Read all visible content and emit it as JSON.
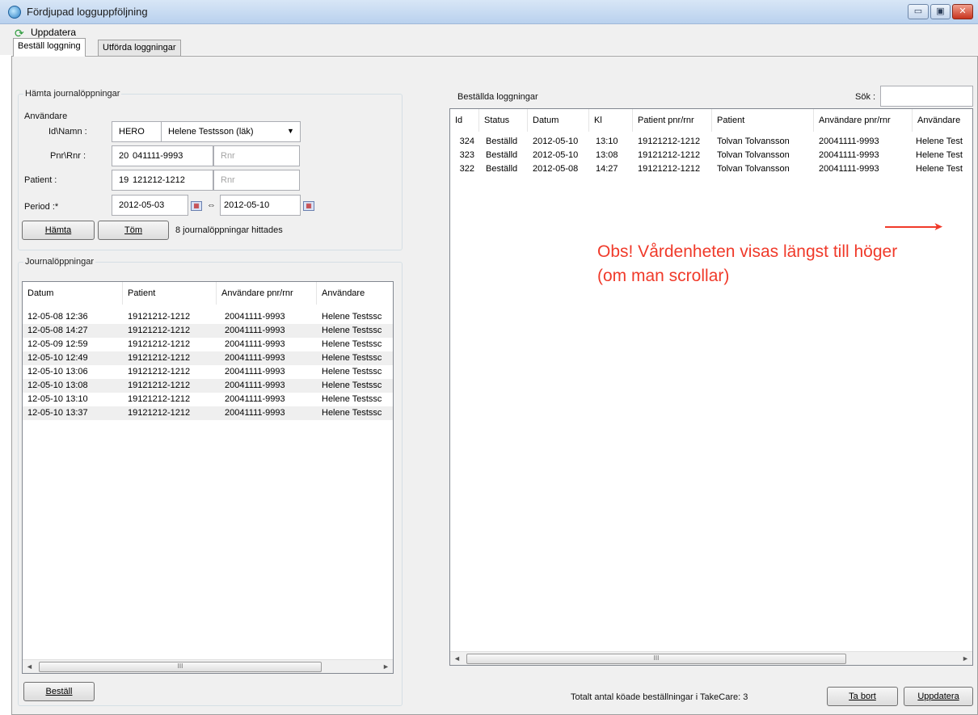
{
  "window": {
    "title": "Fördjupad logguppföljning",
    "minimize": "▭",
    "maximize": "▣",
    "close": "✕"
  },
  "toolbar": {
    "refresh_label": "Uppdatera"
  },
  "tabs": [
    {
      "label": "Beställ loggning",
      "active": true
    },
    {
      "label": "Utförda loggningar",
      "active": false
    }
  ],
  "fetch_group": {
    "legend": "Hämta journalöppningar",
    "user_label": "Användare",
    "idname_label": "Id\\Namn :",
    "user_id": "HERO",
    "user_name": "Helene Testsson (läk)",
    "pnr_label": "Pnr\\Rnr :",
    "user_pnr_century": "20",
    "user_pnr": "041111-9993",
    "rnr_placeholder": "Rnr",
    "patient_label": "Patient :",
    "patient_pnr_century": "19",
    "patient_pnr": "121212-1212",
    "period_label": "Period :*",
    "period_from": "2012-05-03",
    "period_sep": "⇔",
    "period_to": "2012-05-10",
    "fetch_button": "Hämta",
    "clear_button": "Töm",
    "result_text": "8 journalöppningar hittades"
  },
  "openings": {
    "legend": "Journalöppningar",
    "columns": [
      "Datum",
      "Patient",
      "Användare pnr/rnr",
      "Användare"
    ],
    "rows": [
      [
        "12-05-08 12:36",
        "19121212-1212",
        "20041111-9993",
        "Helene Testssc"
      ],
      [
        "12-05-08 14:27",
        "19121212-1212",
        "20041111-9993",
        "Helene Testssc"
      ],
      [
        "12-05-09 12:59",
        "19121212-1212",
        "20041111-9993",
        "Helene Testssc"
      ],
      [
        "12-05-10 12:49",
        "19121212-1212",
        "20041111-9993",
        "Helene Testssc"
      ],
      [
        "12-05-10 13:06",
        "19121212-1212",
        "20041111-9993",
        "Helene Testssc"
      ],
      [
        "12-05-10 13:08",
        "19121212-1212",
        "20041111-9993",
        "Helene Testssc"
      ],
      [
        "12-05-10 13:10",
        "19121212-1212",
        "20041111-9993",
        "Helene Testssc"
      ],
      [
        "12-05-10 13:37",
        "19121212-1212",
        "20041111-9993",
        "Helene Testssc"
      ]
    ],
    "order_button": "Beställ"
  },
  "ordered": {
    "title": "Beställda loggningar",
    "search_label": "Sök :",
    "search_value": "",
    "columns": [
      "Id",
      "Status",
      "Datum",
      "Kl",
      "Patient pnr/rnr",
      "Patient",
      "Användare pnr/rnr",
      "Användare"
    ],
    "rows": [
      [
        "324",
        "Beställd",
        "2012-05-10",
        "13:10",
        "19121212-1212",
        "Tolvan Tolvansson",
        "20041111-9993",
        "Helene Test"
      ],
      [
        "323",
        "Beställd",
        "2012-05-10",
        "13:08",
        "19121212-1212",
        "Tolvan Tolvansson",
        "20041111-9993",
        "Helene Test"
      ],
      [
        "322",
        "Beställd",
        "2012-05-08",
        "14:27",
        "19121212-1212",
        "Tolvan Tolvansson",
        "20041111-9993",
        "Helene Test"
      ]
    ],
    "annotation_line1": "Obs! Vårdenheten visas längst till höger",
    "annotation_line2": "(om man scrollar)",
    "total_text": "Totalt antal köade beställningar i TakeCare: 3",
    "remove_button": "Ta bort",
    "update_button": "Uppdatera"
  },
  "scrollbar": {
    "left_arrow": "◄",
    "right_arrow": "►",
    "grip": "III"
  },
  "colors": {
    "annotation": "#f03a2a",
    "row_alt": "#efefef",
    "title_bar": "#c6dbf3"
  }
}
